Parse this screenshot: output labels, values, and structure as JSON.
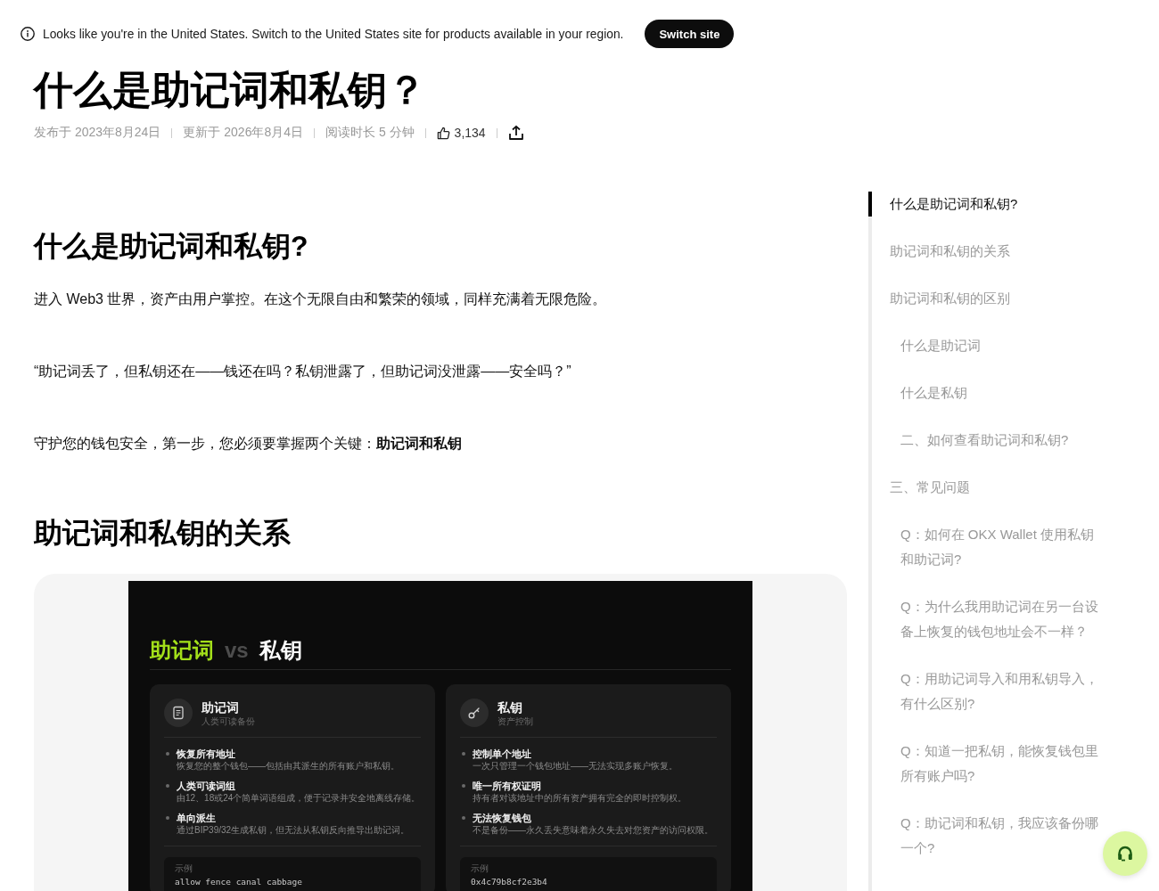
{
  "banner": {
    "message": "Looks like you're in the United States. Switch to the United States site for products available in your region.",
    "button": "Switch site"
  },
  "article": {
    "title": "什么是助记词和私钥？",
    "meta": {
      "published": "发布于 2023年8月24日",
      "updated": "更新于 2026年8月4日",
      "read_time": "阅读时长 5 分钟",
      "likes": "3,134"
    }
  },
  "sections": [
    {
      "heading": "什么是助记词和私钥?",
      "paragraphs": [
        "进入 Web3 世界，资产由用户掌控。在这个无限自由和繁荣的领域，同样充满着无限危险。",
        "“助记词丢了，但私钥还在——钱还在吗？私钥泄露了，但助记词没泄露——安全吗？”",
        "守护您的钱包安全，第一步，您必须要掌握两个关键：**助记词和私钥**"
      ]
    },
    {
      "heading": "助记词和私钥的关系",
      "figure": {
        "title": [
          {
            "text": "助记词",
            "color": "#a3df1a"
          },
          {
            "text": "vs",
            "color": "#4d4d4d"
          },
          {
            "text": "私钥",
            "color": "#ffffff"
          }
        ],
        "cards": [
          {
            "kind": "mnemonic",
            "title": "助记词",
            "subtitle": "人类可读备份",
            "points": [
              {
                "title": "恢复所有地址",
                "text": "恢复您的整个钱包——包括由其派生的所有账户和私钥。"
              },
              {
                "title": "人类可读词组",
                "text": "由12、18或24个简单词语组成，便于记录并安全地离线存储。"
              },
              {
                "title": "单向派生",
                "text": "通过BIP39/32生成私钥，但无法从私钥反向推导出助记词。"
              }
            ],
            "example_label": "示例",
            "example": "allow fence canal cabbage"
          },
          {
            "kind": "private_key",
            "title": "私钥",
            "subtitle": "资产控制",
            "points": [
              {
                "title": "控制单个地址",
                "text": "一次只管理一个钱包地址——无法实现多账户恢复。"
              },
              {
                "title": "唯一所有权证明",
                "text": "持有者对该地址中的所有资产拥有完全的即时控制权。"
              },
              {
                "title": "无法恢复钱包",
                "text": "不是备份——永久丢失意味着永久失去对您资产的访问权限。"
              }
            ],
            "example_label": "示例",
            "example": "0x4c79b8cf2e3b4"
          }
        ]
      }
    }
  ],
  "toc": [
    {
      "label": "什么是助记词和私钥?",
      "selected": true
    },
    {
      "label": "助记词和私钥的关系",
      "selected": false
    },
    {
      "label": "助记词和私钥的区别",
      "selected": false,
      "children": [
        {
          "label": "什么是助记词",
          "selected": false
        },
        {
          "label": "什么是私钥",
          "selected": false
        },
        {
          "label": "二、如何查看助记词和私钥?",
          "selected": false
        }
      ]
    },
    {
      "label": "三、常见问题",
      "selected": false,
      "children": [
        {
          "label": "Q：如何在 OKX Wallet 使用私钥和助记词?",
          "selected": false
        },
        {
          "label": "Q：为什么我用助记词在另一台设备上恢复的钱包地址会不一样？",
          "selected": false
        },
        {
          "label": "Q：用助记词导入和用私钥导入，有什么区别?",
          "selected": false
        },
        {
          "label": "Q：知道一把私钥，能恢复钱包里所有账户吗?",
          "selected": false
        },
        {
          "label": "Q：助记词和私钥，我应该备份哪一个?",
          "selected": false
        }
      ]
    }
  ]
}
